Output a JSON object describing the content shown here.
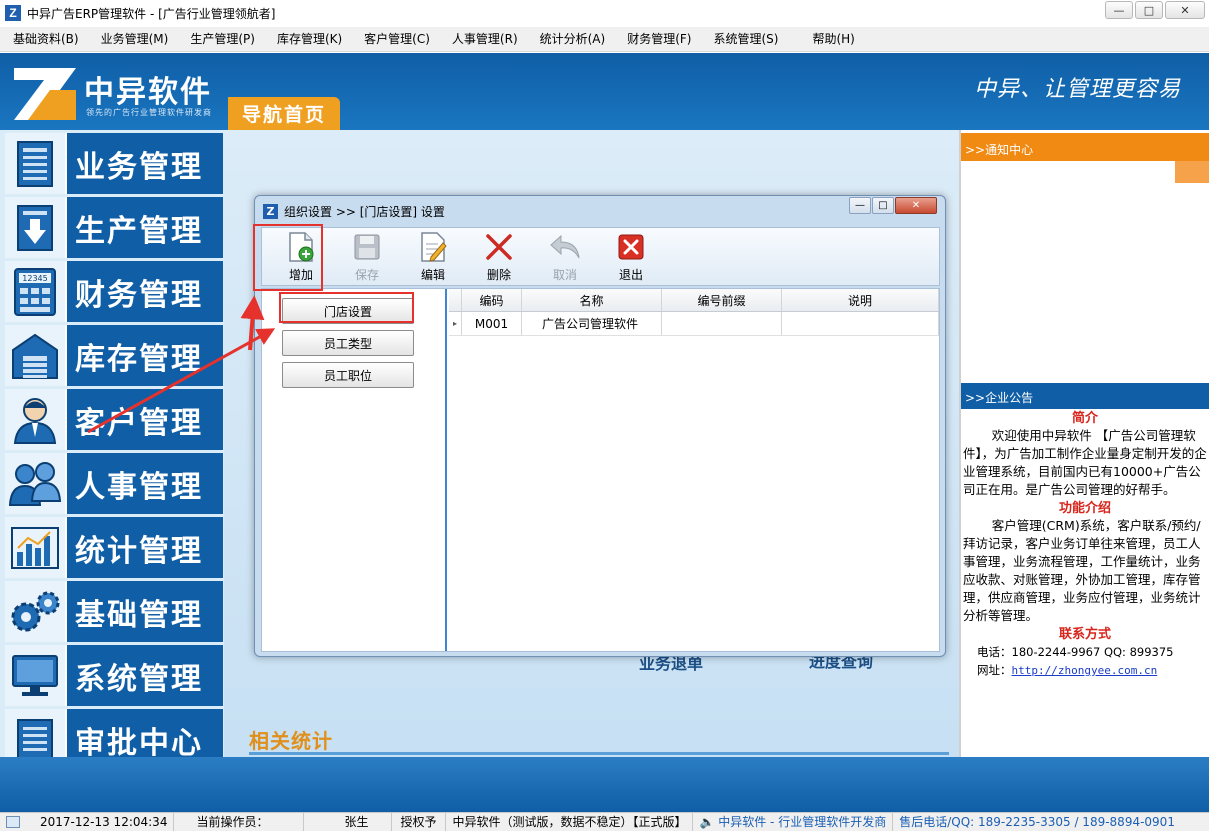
{
  "window": {
    "title": "中异广告ERP管理软件 - [广告行业管理领航者]",
    "controls": [
      "—",
      "□",
      "✕"
    ]
  },
  "menu": [
    "基础资料(B)",
    "业务管理(M)",
    "生产管理(P)",
    "库存管理(K)",
    "客户管理(C)",
    "人事管理(R)",
    "统计分析(A)",
    "财务管理(F)",
    "系统管理(S)",
    "帮助(H)"
  ],
  "banner": {
    "logo_title": "中异软件",
    "logo_sub": "领先的广告行业管理软件研发商",
    "nav_home": "导航首页",
    "slogan": "中异、让管理更容易"
  },
  "modules": [
    {
      "label": "业务管理",
      "icon": "document-list-icon"
    },
    {
      "label": "生产管理",
      "icon": "download-box-icon"
    },
    {
      "label": "财务管理",
      "icon": "calculator-icon"
    },
    {
      "label": "库存管理",
      "icon": "warehouse-icon"
    },
    {
      "label": "客户管理",
      "icon": "customer-icon"
    },
    {
      "label": "人事管理",
      "icon": "people-icon"
    },
    {
      "label": "统计管理",
      "icon": "statistics-chart-icon"
    },
    {
      "label": "基础管理",
      "icon": "gears-icon"
    },
    {
      "label": "系统管理",
      "icon": "monitor-icon"
    },
    {
      "label": "审批中心",
      "icon": "approval-document-icon"
    }
  ],
  "main": {
    "bg_label_1": "业务退单",
    "bg_label_2": "进度查询",
    "stats_label": "相关统计"
  },
  "right_panel": {
    "notice_header": ">>通知中心",
    "company_header": ">>企业公告",
    "intro_title": "简介",
    "intro_text": "欢迎使用中异软件 【广告公司管理软件】，为广告加工制作企业量身定制开发的企业管理系统，目前国内已有10000+广告公司正在用。是广告公司管理的好帮手。",
    "features_title": "功能介绍",
    "features_text": "客户管理(CRM)系统，客户联系/预约/拜访记录，客户业务订单往来管理，员工人事管理，业务流程管理，工作量统计，业务应收款、对账管理，外协加工管理，库存管理，供应商管理，业务应付管理，业务统计分析等管理。",
    "contact_title": "联系方式",
    "phone_line": "电话：180-2244-9967  QQ: 899375",
    "site_label": "网址：",
    "site_url": "http://zhongyee.com.cn"
  },
  "dialog": {
    "title": "组织设置 >> [门店设置] 设置",
    "toolbar": [
      {
        "label": "增加",
        "icon": "add-document-icon",
        "enabled": true
      },
      {
        "label": "保存",
        "icon": "save-disk-icon",
        "enabled": false
      },
      {
        "label": "编辑",
        "icon": "edit-document-icon",
        "enabled": true
      },
      {
        "label": "删除",
        "icon": "delete-x-icon",
        "enabled": true
      },
      {
        "label": "取消",
        "icon": "undo-arrow-icon",
        "enabled": false
      },
      {
        "label": "退出",
        "icon": "exit-red-icon",
        "enabled": true
      }
    ],
    "left_list": [
      "门店设置",
      "员工类型",
      "员工职位"
    ],
    "grid": {
      "columns": [
        "编码",
        "名称",
        "编号前缀",
        "说明"
      ],
      "rows": [
        {
          "code": "M001",
          "name": "广告公司管理软件",
          "prefix": "",
          "note": ""
        }
      ]
    }
  },
  "status_bar": {
    "datetime": "2017-12-13 12:04:34",
    "operator_label": "当前操作员：",
    "operator": "张生",
    "license_label": "授权予",
    "license": "中异软件（测试版，数据不稳定）【正式版】",
    "vendor": "中异软件 - 行业管理软件开发商",
    "hotline": "售后电话/QQ: 189-2235-3305 / 189-8894-0901"
  },
  "colors": {
    "brand_blue": "#0f5ea6",
    "accent_orange": "#f0a021",
    "highlight_red": "#e5322d"
  }
}
